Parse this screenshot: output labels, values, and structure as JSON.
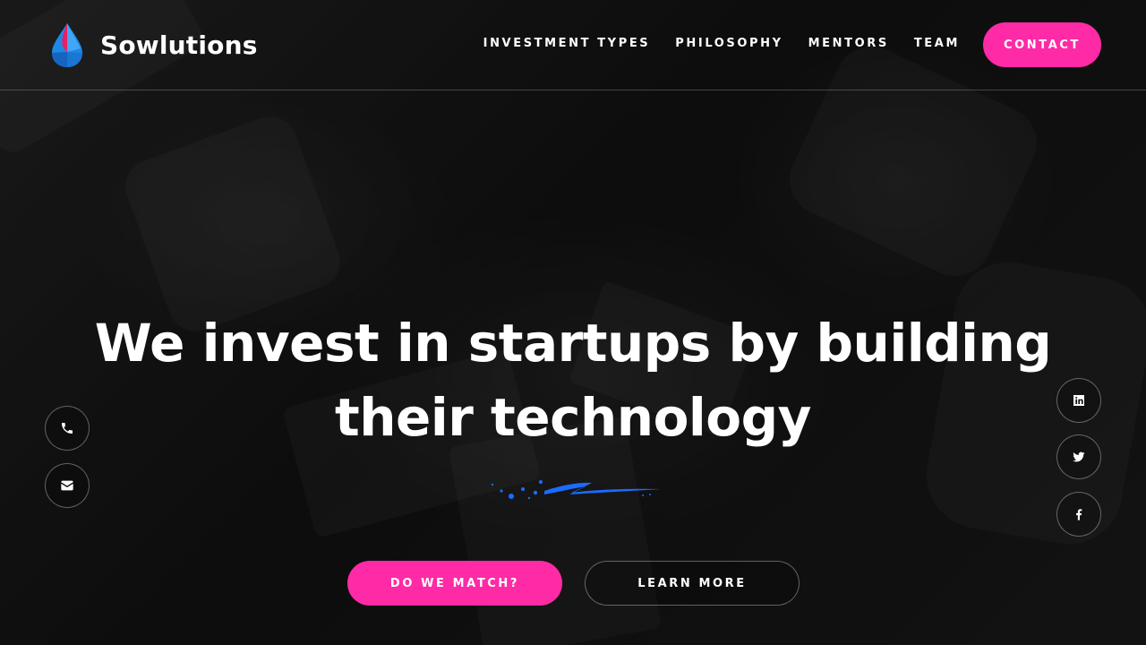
{
  "brand": {
    "name": "Sowlutions",
    "logo_icon": "droplet-logo-icon"
  },
  "nav": {
    "items": [
      {
        "label": "INVESTMENT TYPES"
      },
      {
        "label": "PHILOSOPHY"
      },
      {
        "label": "MENTORS"
      },
      {
        "label": "TEAM"
      }
    ],
    "contact_label": "CONTACT"
  },
  "hero": {
    "title_line1": "We invest in startups by building",
    "title_line2": "their technology",
    "primary_button": "DO WE MATCH?",
    "secondary_button": "LEARN MORE"
  },
  "left_actions": [
    {
      "icon": "phone-icon"
    },
    {
      "icon": "envelope-icon"
    }
  ],
  "social": [
    {
      "icon": "linkedin-icon"
    },
    {
      "icon": "twitter-icon"
    },
    {
      "icon": "facebook-icon"
    }
  ],
  "colors": {
    "accent": "#ff2aa5",
    "squiggle": "#1a6cff",
    "logo_blue": "#1e88e5",
    "logo_pink": "#e91e63"
  }
}
